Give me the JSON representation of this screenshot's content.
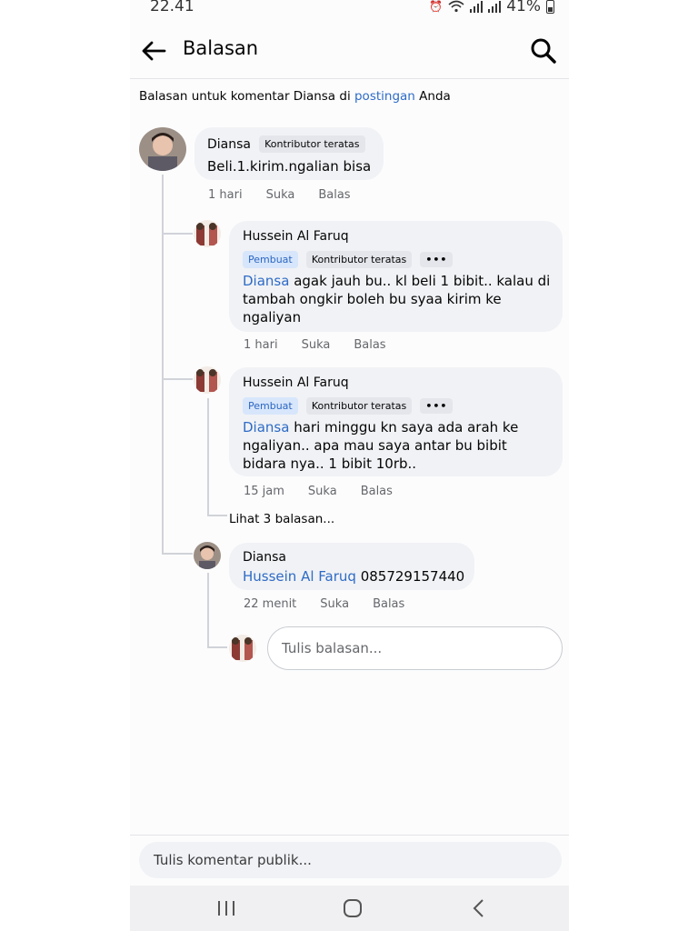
{
  "status": {
    "time": "22.41",
    "battery": "41%"
  },
  "header": {
    "title": "Balasan"
  },
  "context": {
    "prefix": "Balasan untuk komentar Diansa di ",
    "link": "postingan",
    "suffix": " Anda"
  },
  "comments": [
    {
      "name": "Diansa",
      "badge": "Kontributor teratas",
      "text": "Beli.1.kirim.ngalian bisa",
      "time": "1 hari",
      "like": "Suka",
      "reply": "Balas"
    },
    {
      "name": "Hussein Al Faruq",
      "badge_author": "Pembuat",
      "badge": "Kontributor teratas",
      "mention": "Diansa",
      "text": " agak jauh bu.. kl beli 1 bibit.. kalau di tambah ongkir boleh bu syaa kirim ke ngaliyan",
      "time": "1 hari",
      "like": "Suka",
      "reply": "Balas"
    },
    {
      "name": "Hussein Al Faruq",
      "badge_author": "Pembuat",
      "badge": "Kontributor teratas",
      "mention": "Diansa",
      "text": " hari minggu kn saya ada arah ke ngaliyan.. apa mau saya antar bu bibit bidara nya.. 1 bibit 10rb..",
      "time": "15 jam",
      "like": "Suka",
      "reply": "Balas"
    },
    {
      "name": "Diansa",
      "mention": "Hussein Al Faruq",
      "text": " 085729157440",
      "time": "22 menit",
      "like": "Suka",
      "reply": "Balas"
    }
  ],
  "more_replies": "Lihat 3 balasan...",
  "reply_placeholder": "Tulis balasan...",
  "public_comment_placeholder": "Tulis komentar publik...",
  "icons": {
    "back": "arrow-left-icon",
    "search": "search-icon",
    "more": "more-dots-icon"
  },
  "colors": {
    "link": "#2e6bc6",
    "bubble": "#f0f2f5",
    "author_badge": "#d7e6fb"
  }
}
